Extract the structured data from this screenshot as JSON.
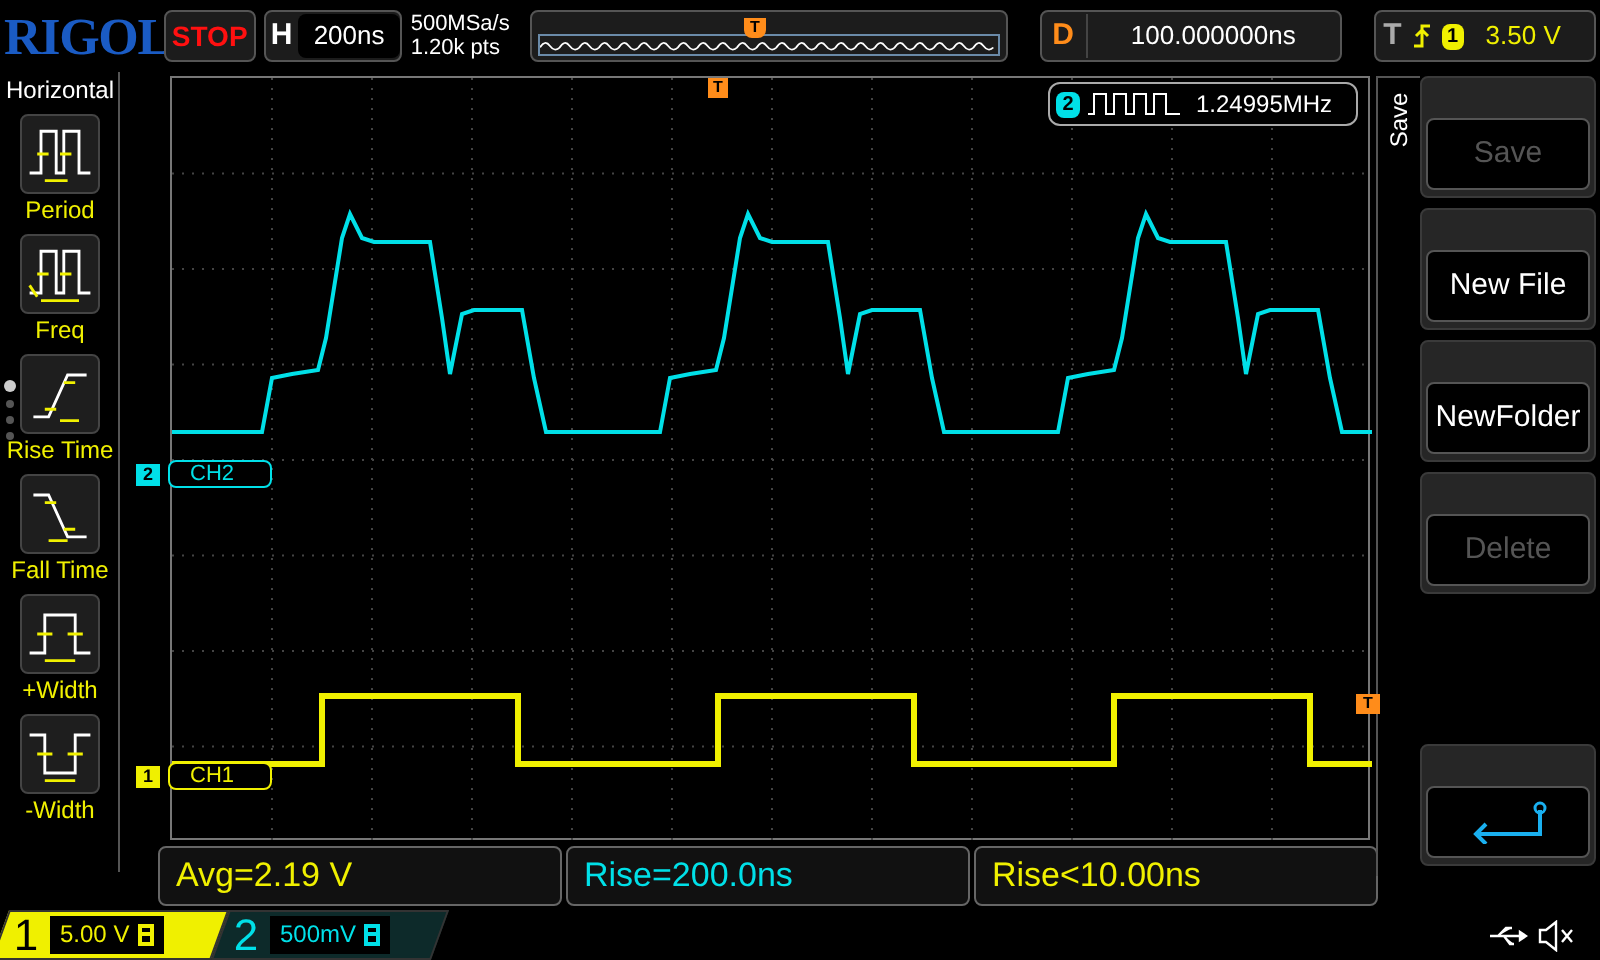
{
  "logo": "RIGOL",
  "run_state": {
    "label": "STOP"
  },
  "timebase": {
    "key": "H",
    "value": "200ns"
  },
  "acquisition": {
    "sample_rate": "500MSa/s",
    "memory_depth": "1.20k pts"
  },
  "memory_bar": {
    "trigger_mark": "T"
  },
  "delay": {
    "key": "D",
    "value": "100.000000ns"
  },
  "trigger": {
    "key": "T",
    "source": "1",
    "level": "3.50 V"
  },
  "left_menu": {
    "title": "Horizontal",
    "items": [
      {
        "label": "Period",
        "kind": "period"
      },
      {
        "label": "Freq",
        "kind": "freq"
      },
      {
        "label": "Rise Time",
        "kind": "rise"
      },
      {
        "label": "Fall Time",
        "kind": "fall"
      },
      {
        "label": "+Width",
        "kind": "pwidth"
      },
      {
        "label": "-Width",
        "kind": "nwidth"
      }
    ],
    "page_dots": [
      {
        "selected": true
      },
      {
        "selected": false
      },
      {
        "selected": false
      },
      {
        "selected": false
      }
    ]
  },
  "grid": {
    "trigger_position_mark": "T",
    "trigger_level_mark": "T"
  },
  "freq_counter": {
    "channel": "2",
    "value": "1.24995MHz"
  },
  "channel_labels": [
    {
      "number": "2",
      "name": "CH2",
      "color": "#00e0e8"
    },
    {
      "number": "1",
      "name": "CH1",
      "color": "#f0f000"
    }
  ],
  "measurements": [
    {
      "text": "Avg=2.19 V",
      "color": "#f0f000"
    },
    {
      "text": "Rise=200.0ns",
      "color": "#00e0e8"
    },
    {
      "text": "Rise<10.00ns",
      "color": "#f0f000"
    }
  ],
  "right_menu": {
    "title": "Save",
    "items": [
      {
        "kind": "text",
        "label": "Save",
        "disabled": true
      },
      {
        "kind": "text",
        "label": "New File",
        "disabled": false
      },
      {
        "kind": "text",
        "label": "NewFolder",
        "disabled": false
      },
      {
        "kind": "text",
        "label": "Delete",
        "disabled": true
      },
      {
        "kind": "back"
      }
    ]
  },
  "channels": [
    {
      "number": "1",
      "scale": "5.00 V",
      "color": "#f0f000",
      "active": true
    },
    {
      "number": "2",
      "scale": "500mV",
      "color": "#00e0e8",
      "active": false
    }
  ]
}
